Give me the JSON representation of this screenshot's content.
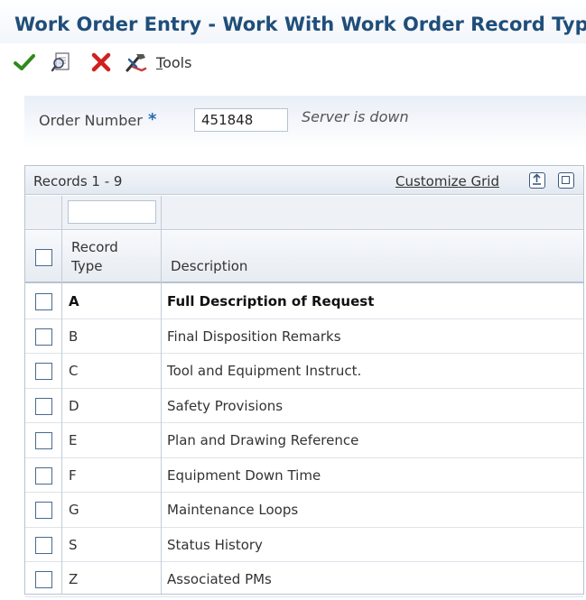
{
  "window": {
    "title": "Work Order Entry - Work With Work Order Record Types"
  },
  "toolbar": {
    "select_icon": "checkmark-icon",
    "find_icon": "find-icon",
    "close_icon": "close-x-icon",
    "tools_icon": "tools-icon",
    "tools_label_first": "T",
    "tools_label_rest": "ools"
  },
  "header": {
    "order_number_label": "Order Number",
    "required_marker": "*",
    "order_number_value": "451848",
    "server_status": "Server is down"
  },
  "grid": {
    "records_label": "Records 1 - 9",
    "customize_label": "Customize Grid",
    "columns": {
      "record_type_line1": "Record",
      "record_type_line2": "Type",
      "description": "Description"
    },
    "rows": [
      {
        "type": "A",
        "description": "Full Description of Request",
        "bold": true
      },
      {
        "type": "B",
        "description": "Final Disposition Remarks"
      },
      {
        "type": "C",
        "description": "Tool and Equipment Instruct."
      },
      {
        "type": "D",
        "description": "Safety Provisions"
      },
      {
        "type": "E",
        "description": "Plan and Drawing Reference"
      },
      {
        "type": "F",
        "description": "Equipment Down Time"
      },
      {
        "type": "G",
        "description": "Maintenance Loops"
      },
      {
        "type": "S",
        "description": "Status History"
      },
      {
        "type": "Z",
        "description": "Associated PMs"
      }
    ]
  },
  "colors": {
    "title": "#1f4e7a",
    "accept_green": "#2f8a1c",
    "close_red": "#d02020"
  }
}
